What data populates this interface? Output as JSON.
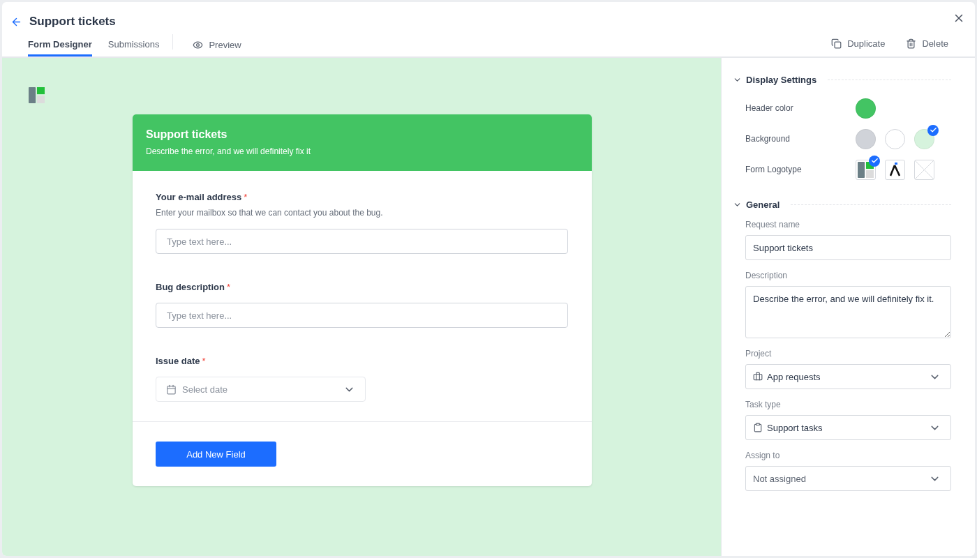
{
  "header": {
    "title": "Support tickets",
    "tabs": [
      {
        "label": "Form Designer",
        "selected": true
      },
      {
        "label": "Submissions",
        "selected": false
      }
    ],
    "preview": "Preview",
    "actions": [
      {
        "kind": "duplicate",
        "label": "Duplicate"
      },
      {
        "kind": "delete",
        "label": "Delete"
      }
    ]
  },
  "form": {
    "title": "Support tickets",
    "subtitle": "Describe the error, and we will definitely fix it",
    "fields": [
      {
        "kind": "text",
        "label": "Your e-mail address",
        "required_mark": "*",
        "hint": "Enter your mailbox so that we can contact you about the bug.",
        "placeholder": "Type text here..."
      },
      {
        "kind": "text",
        "label": "Bug description",
        "required_mark": "*",
        "placeholder": "Type text here..."
      },
      {
        "kind": "date",
        "label": "Issue date",
        "required_mark": "*",
        "placeholder": "Select date"
      }
    ],
    "add_button": "Add New Field"
  },
  "settings": {
    "display": {
      "title": "Display Settings",
      "expanded": true,
      "header_color": {
        "label": "Header color",
        "color": "#43c463"
      },
      "background": {
        "label": "Background",
        "options": [
          {
            "color": "#d0d3d9",
            "selected": false
          },
          {
            "color": "#ffffff",
            "selected": false
          },
          {
            "color": "#d6f3dd",
            "selected": true
          }
        ]
      },
      "logotype": {
        "label": "Form Logotype",
        "options": [
          {
            "kind": "blocks",
            "selected": true
          },
          {
            "kind": "letter",
            "selected": false
          },
          {
            "kind": "none",
            "selected": false
          }
        ]
      }
    },
    "general": {
      "title": "General",
      "expanded": true,
      "fields": [
        {
          "kind": "input",
          "label": "Request name",
          "value": "Support tickets"
        },
        {
          "kind": "textarea",
          "label": "Description",
          "value": "Describe the error, and we will definitely fix it."
        },
        {
          "kind": "project",
          "label": "Project",
          "value": "App requests"
        },
        {
          "kind": "tasktype",
          "label": "Task type",
          "value": "Support tasks"
        },
        {
          "kind": "assignee",
          "label": "Assign to",
          "value": "Not assigned"
        }
      ]
    }
  }
}
